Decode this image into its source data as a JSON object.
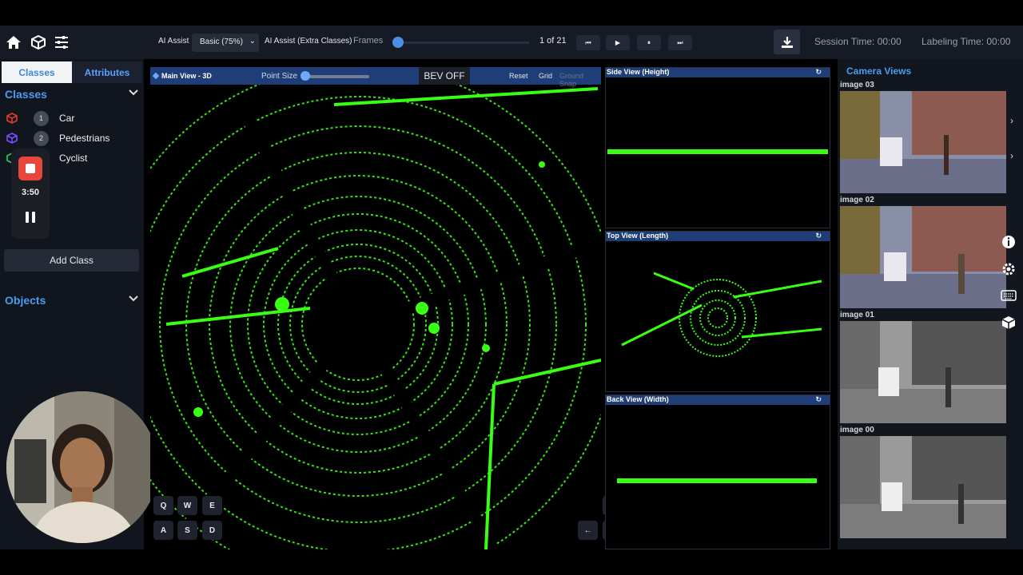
{
  "toolbar": {
    "ai_assist_label": "AI Assist",
    "ai_mode_value": "Basic (75%)",
    "ai_extra_label": "AI Assist (Extra Classes)",
    "frames_label": "Frames",
    "frame_position": 0.0,
    "frame_count_text": "1 of 21",
    "session_time": "Session Time: 00:00",
    "labeling_time": "Labeling Time: 00:00",
    "icons": [
      "home-icon",
      "cube-icon",
      "sliders-icon",
      "skip-back-icon",
      "play-icon",
      "pause-icon",
      "skip-forward-icon",
      "download-icon"
    ]
  },
  "sidebar": {
    "tabs": [
      {
        "label": "Classes"
      },
      {
        "label": "Attributes"
      }
    ],
    "classes_title": "Classes",
    "classes": [
      {
        "num": "1",
        "name": "Car",
        "color": "#e53935"
      },
      {
        "num": "2",
        "name": "Pedestrians",
        "color": "#7c4dff"
      },
      {
        "num": "",
        "name": "Cyclist",
        "color": "#2ecc71"
      }
    ],
    "recording_time": "3:50",
    "add_class_label": "Add Class",
    "objects_title": "Objects"
  },
  "main_view": {
    "title": "Main View - 3D",
    "point_size_label": "Point Size",
    "point_size_level": 0.0,
    "bev_label": "BEV OFF",
    "reset_label": "Reset",
    "grid_label": "Grid",
    "ground_snap_label": "Ground Snap",
    "keys": [
      "Q",
      "W",
      "E",
      "A",
      "S",
      "D"
    ],
    "arrows": [
      "↑",
      "←",
      "↓",
      "→"
    ]
  },
  "subviews": [
    {
      "title": "Side View (Height)"
    },
    {
      "title": "Top View (Length)"
    },
    {
      "title": "Back View (Width)"
    }
  ],
  "refresh_glyph": "↻",
  "camera": {
    "title": "Camera Views",
    "images": [
      {
        "label": "image 03"
      },
      {
        "label": "image 02"
      },
      {
        "label": "image 01"
      },
      {
        "label": "image 00"
      }
    ]
  },
  "colors": {
    "accent": "#4a9cf2",
    "lidar_green": "#39ff14",
    "header_blue": "#1f3e78",
    "record_red": "#e8453c"
  }
}
